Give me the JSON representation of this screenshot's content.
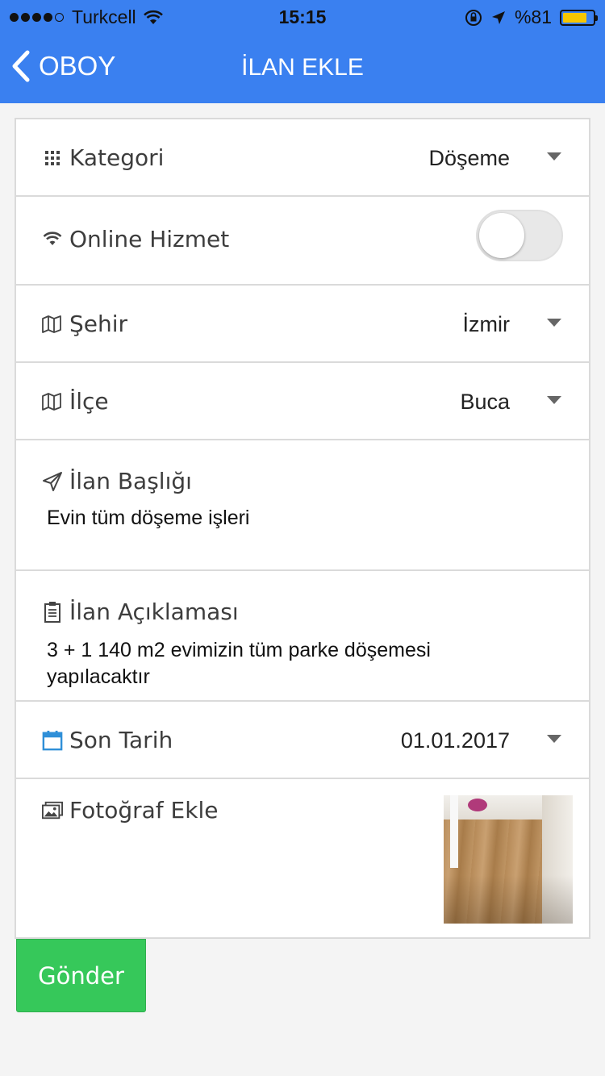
{
  "status_bar": {
    "carrier": "Turkcell",
    "time": "15:15",
    "battery_text": "%81",
    "battery_level": 0.81,
    "signal_bars_filled": 4,
    "signal_bars_total": 5,
    "battery_color": "#f7c600"
  },
  "nav": {
    "back_label": "OBOY",
    "title": "İLAN EKLE",
    "background_color": "#3a80f0"
  },
  "form": {
    "category": {
      "label": "Kategori",
      "value": "Döşeme",
      "icon": "grid-icon"
    },
    "online_service": {
      "label": "Online Hizmet",
      "icon": "wifi-icon",
      "enabled": false
    },
    "city": {
      "label": "Şehir",
      "value": "İzmir",
      "icon": "map-icon"
    },
    "district": {
      "label": "İlçe",
      "value": "Buca",
      "icon": "map-icon"
    },
    "title_field": {
      "label": "İlan Başlığı",
      "value": "Evin tüm döşeme işleri",
      "icon": "paper-plane-icon"
    },
    "description": {
      "label": "İlan Açıklaması",
      "value_line1": "3 + 1 140 m2 evimizin tüm parke döşemesi",
      "value_line2": "yapılacaktır",
      "icon": "clipboard-icon"
    },
    "deadline": {
      "label": "Son Tarih",
      "value": "01.01.2017",
      "icon": "calendar-icon",
      "icon_color": "#2f8fd8"
    },
    "photo": {
      "label": "Fotoğraf Ekle",
      "icon": "image-icon"
    }
  },
  "submit": {
    "label": "Gönder",
    "color": "#36c85a"
  }
}
